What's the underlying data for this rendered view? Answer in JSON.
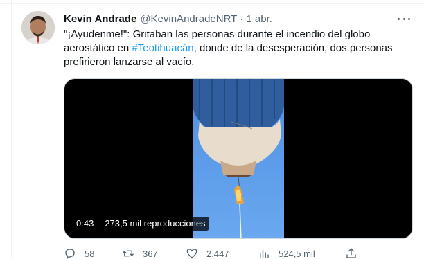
{
  "tweet": {
    "author": {
      "name": "Kevin Andrade",
      "handle": "@KevinAndradeNRT",
      "separator": "·",
      "date": "1 abr."
    },
    "text": {
      "before": "\"¡Ayudenme!\": Gritaban las personas durante el incendio del globo aerostático en ",
      "hashtag": "#Teotihuacán",
      "after": ", donde de la desesperación, dos personas prefirieron lanzarse al vacío."
    },
    "video": {
      "duration": "0:43",
      "views": "273,5 mil reproducciones"
    },
    "actions": {
      "replies": "58",
      "retweets": "367",
      "likes": "2.447",
      "views": "524,5 mil"
    }
  }
}
